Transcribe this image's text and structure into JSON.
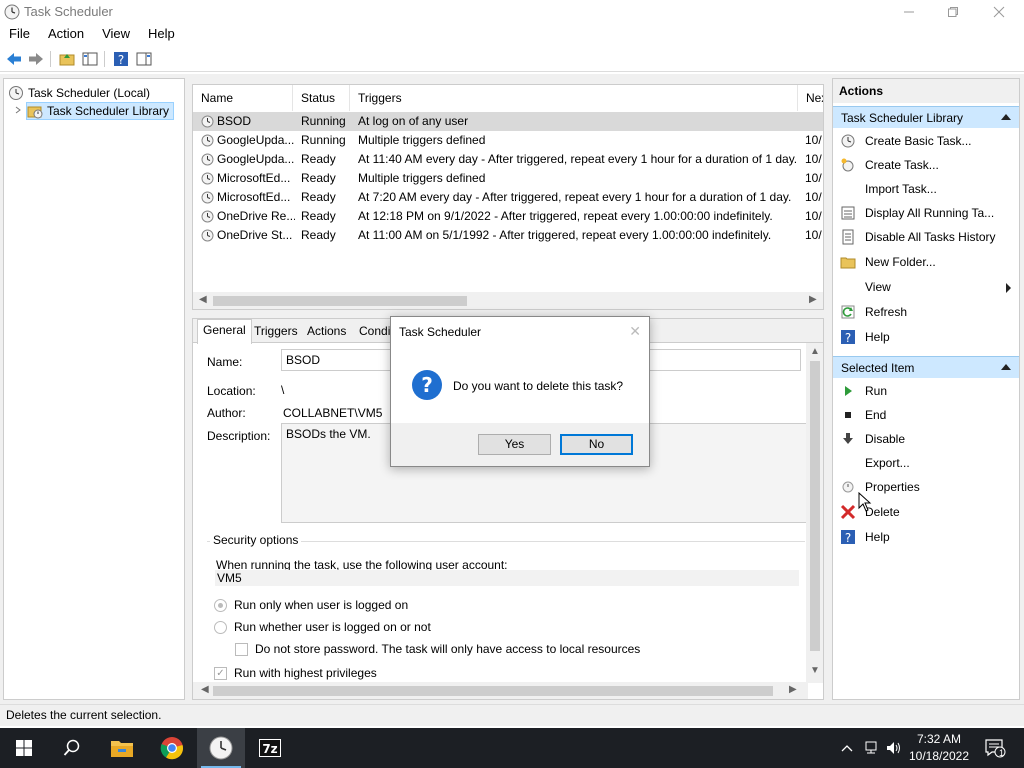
{
  "window": {
    "title": "Task Scheduler",
    "menus": [
      "File",
      "Action",
      "View",
      "Help"
    ]
  },
  "tree": {
    "root": "Task Scheduler (Local)",
    "library": "Task Scheduler Library"
  },
  "tasklist": {
    "columns": [
      "Name",
      "Status",
      "Triggers",
      "Nex"
    ],
    "rows": [
      {
        "name": "BSOD",
        "status": "Running",
        "triggers": "At log on of any user",
        "next": ""
      },
      {
        "name": "GoogleUpda...",
        "status": "Running",
        "triggers": "Multiple triggers defined",
        "next": "10/"
      },
      {
        "name": "GoogleUpda...",
        "status": "Ready",
        "triggers": "At 11:40 AM every day - After triggered, repeat every 1 hour for a duration of 1 day.",
        "next": "10/"
      },
      {
        "name": "MicrosoftEd...",
        "status": "Ready",
        "triggers": "Multiple triggers defined",
        "next": "10/"
      },
      {
        "name": "MicrosoftEd...",
        "status": "Ready",
        "triggers": "At 7:20 AM every day - After triggered, repeat every 1 hour for a duration of 1 day.",
        "next": "10/"
      },
      {
        "name": "OneDrive Re...",
        "status": "Ready",
        "triggers": "At 12:18 PM on 9/1/2022 - After triggered, repeat every 1.00:00:00 indefinitely.",
        "next": "10/"
      },
      {
        "name": "OneDrive St...",
        "status": "Ready",
        "triggers": "At 11:00 AM on 5/1/1992 - After triggered, repeat every 1.00:00:00 indefinitely.",
        "next": "10/"
      }
    ]
  },
  "details": {
    "tabs": [
      "General",
      "Triggers",
      "Actions",
      "Condi"
    ],
    "name_label": "Name:",
    "name_value": "BSOD",
    "location_label": "Location:",
    "location_value": "\\",
    "author_label": "Author:",
    "author_value": "COLLABNET\\VM5",
    "description_label": "Description:",
    "description_value": "BSODs the VM.",
    "security_title": "Security options",
    "account_prompt": "When running the task, use the following user account:",
    "account_value": "VM5",
    "radio1": "Run only when user is logged on",
    "radio2": "Run whether user is logged on or not",
    "check_password": "Do not store password.  The task will only have access to local resources",
    "check_highest": "Run with highest privileges"
  },
  "actions": {
    "header": "Actions",
    "section1": "Task Scheduler Library",
    "items1": [
      "Create Basic Task...",
      "Create Task...",
      "Import Task...",
      "Display All Running Ta...",
      "Disable All Tasks History",
      "New Folder...",
      "View",
      "Refresh",
      "Help"
    ],
    "section2": "Selected Item",
    "items2": [
      "Run",
      "End",
      "Disable",
      "Export...",
      "Properties",
      "Delete",
      "Help"
    ]
  },
  "status": "Deletes the current selection.",
  "dialog": {
    "title": "Task Scheduler",
    "message": "Do you want to delete this task?",
    "yes": "Yes",
    "no": "No"
  },
  "taskbar": {
    "time": "7:32 AM",
    "date": "10/18/2022",
    "notifications": "1"
  },
  "colors": {
    "selection": "#cde8ff",
    "accent": "#0078d7",
    "taskbar": "#1c1f24"
  }
}
